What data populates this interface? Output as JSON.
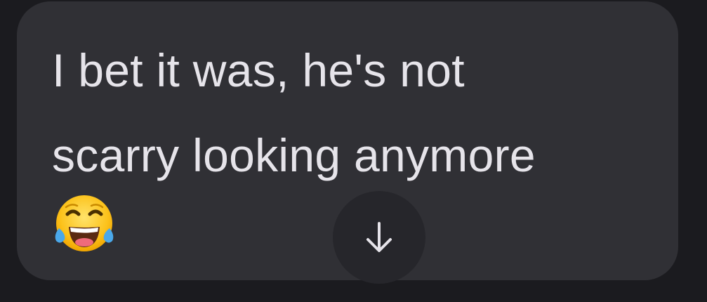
{
  "message": {
    "text_line1": "I bet it was, he's not",
    "text_line2": "scarry looking anymore",
    "emoji": "face-with-tears-of-joy"
  },
  "scroll_button": {
    "icon": "arrow-down-icon"
  },
  "colors": {
    "background": "#1b1b1f",
    "bubble": "#303035",
    "text": "#e6e4ea",
    "scroll_button_bg": "#26262b",
    "scroll_button_icon": "#e6e4ea"
  }
}
